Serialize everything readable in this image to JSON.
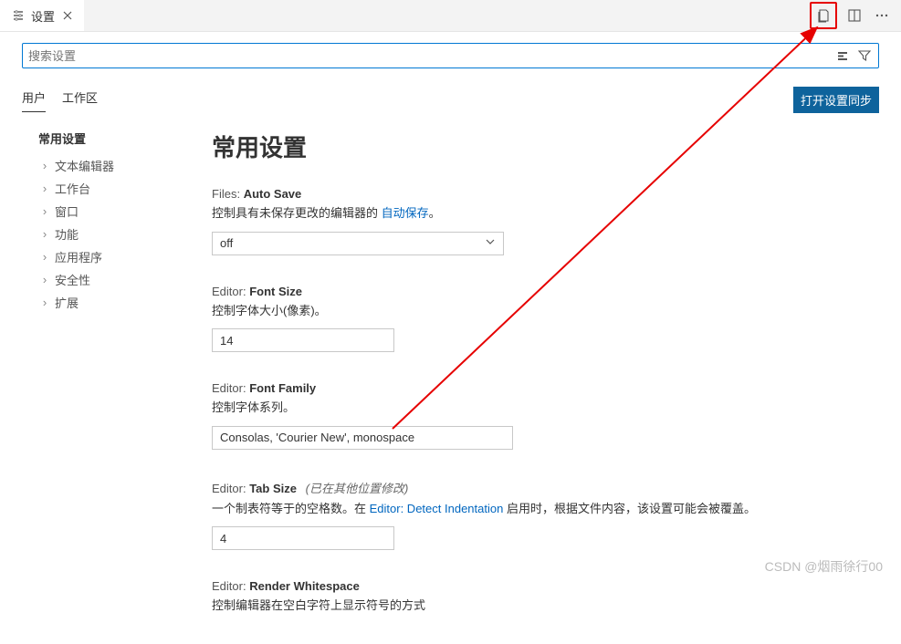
{
  "tab": {
    "label": "设置"
  },
  "search": {
    "placeholder": "搜索设置"
  },
  "scope": {
    "user": "用户",
    "workspace": "工作区"
  },
  "sync_button": "打开设置同步",
  "sidebar": {
    "heading": "常用设置",
    "items": [
      {
        "label": "文本编辑器"
      },
      {
        "label": "工作台"
      },
      {
        "label": "窗口"
      },
      {
        "label": "功能"
      },
      {
        "label": "应用程序"
      },
      {
        "label": "安全性"
      },
      {
        "label": "扩展"
      }
    ]
  },
  "section_title": "常用设置",
  "settings": {
    "autoSave": {
      "prefix": "Files:",
      "name": "Auto Save",
      "desc_before": "控制具有未保存更改的编辑器的 ",
      "desc_link": "自动保存",
      "desc_after": "。",
      "value": "off"
    },
    "fontSize": {
      "prefix": "Editor:",
      "name": "Font Size",
      "desc": "控制字体大小(像素)。",
      "value": "14"
    },
    "fontFamily": {
      "prefix": "Editor:",
      "name": "Font Family",
      "desc": "控制字体系列。",
      "value": "Consolas, 'Courier New', monospace"
    },
    "tabSize": {
      "prefix": "Editor:",
      "name": "Tab Size",
      "modified": "(已在其他位置修改)",
      "desc_before": "一个制表符等于的空格数。在 ",
      "desc_link": "Editor: Detect Indentation",
      "desc_after": " 启用时，根据文件内容，该设置可能会被覆盖。",
      "value": "4"
    },
    "renderWs": {
      "prefix": "Editor:",
      "name": "Render Whitespace",
      "desc": "控制编辑器在空白字符上显示符号的方式"
    }
  },
  "watermark": "CSDN @烟雨徐行00"
}
